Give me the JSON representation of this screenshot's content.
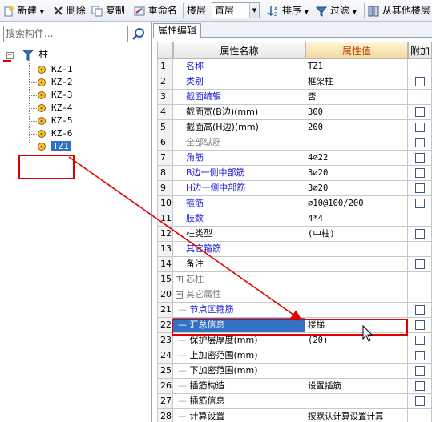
{
  "toolbar": {
    "new_label": "新建",
    "delete_label": "删除",
    "copy_label": "复制",
    "rename_label": "重命名",
    "floor_label": "楼层",
    "floor_value": "首层",
    "sort_label": "排序",
    "filter_label": "过滤",
    "from_other_label": "从其他楼层"
  },
  "search": {
    "placeholder": "搜索构件..."
  },
  "tree": {
    "root_label": "柱",
    "items": [
      "KZ-1",
      "KZ-2",
      "KZ-3",
      "KZ-4",
      "KZ-5",
      "KZ-6",
      "TZ1"
    ],
    "selected": "TZ1"
  },
  "panel": {
    "tab_label": "属性编辑"
  },
  "grid": {
    "headers": {
      "name": "属性名称",
      "value": "属性值",
      "add": "附加"
    },
    "rows": [
      {
        "num": "1",
        "name": "名称",
        "value": "TZ1",
        "style": "blue",
        "check": false
      },
      {
        "num": "2",
        "name": "类别",
        "value": "框架柱",
        "style": "blue",
        "check": true
      },
      {
        "num": "3",
        "name": "截面编辑",
        "value": "否",
        "style": "blue",
        "check": false
      },
      {
        "num": "4",
        "name": "截面宽(B边)(mm)",
        "value": "300",
        "style": "black",
        "check": true
      },
      {
        "num": "5",
        "name": "截面高(H边)(mm)",
        "value": "200",
        "style": "black",
        "check": true
      },
      {
        "num": "6",
        "name": "全部纵筋",
        "value": "",
        "style": "gray",
        "check": true
      },
      {
        "num": "7",
        "name": "角筋",
        "value": "4⌀22",
        "style": "blue",
        "check": true
      },
      {
        "num": "8",
        "name": "B边一侧中部筋",
        "value": "3⌀20",
        "style": "blue",
        "check": true
      },
      {
        "num": "9",
        "name": "H边一侧中部筋",
        "value": "3⌀20",
        "style": "blue",
        "check": true
      },
      {
        "num": "10",
        "name": "箍筋",
        "value": "⌀10@100/200",
        "style": "blue",
        "check": true
      },
      {
        "num": "11",
        "name": "肢数",
        "value": "4*4",
        "style": "blue",
        "check": false
      },
      {
        "num": "12",
        "name": "柱类型",
        "value": "(中柱)",
        "style": "black",
        "check": true
      },
      {
        "num": "13",
        "name": "其它箍筋",
        "value": "",
        "style": "blue",
        "check": false
      },
      {
        "num": "14",
        "name": "备注",
        "value": "",
        "style": "black",
        "check": true
      },
      {
        "num": "15",
        "name": "芯柱",
        "value": "",
        "style": "gray-group-plus",
        "check": false
      },
      {
        "num": "20",
        "name": "其它属性",
        "value": "",
        "style": "gray-group-minus",
        "check": false
      },
      {
        "num": "21",
        "name": "节点区箍筋",
        "value": "",
        "style": "blue-child",
        "check": true
      },
      {
        "num": "22",
        "name": "汇总信息",
        "value": "楼梯",
        "style": "selected",
        "check": true
      },
      {
        "num": "23",
        "name": "保护层厚度(mm)",
        "value": "(20)",
        "style": "black-child",
        "check": true
      },
      {
        "num": "24",
        "name": "上加密范围(mm)",
        "value": "",
        "style": "black-child",
        "check": true
      },
      {
        "num": "25",
        "name": "下加密范围(mm)",
        "value": "",
        "style": "black-child",
        "check": true
      },
      {
        "num": "26",
        "name": "插筋构造",
        "value": "设置插筋",
        "style": "black-child",
        "check": true
      },
      {
        "num": "27",
        "name": "插筋信息",
        "value": "",
        "style": "black-child",
        "check": true
      },
      {
        "num": "28",
        "name": "计算设置",
        "value": "按默认计算设置计算",
        "style": "black-child",
        "check": false
      }
    ]
  },
  "colors": {
    "annotation_red": "#e00000",
    "selection_blue": "#3271c4",
    "label_blue": "#1b1bd8",
    "header_orange_text": "#c04000"
  }
}
